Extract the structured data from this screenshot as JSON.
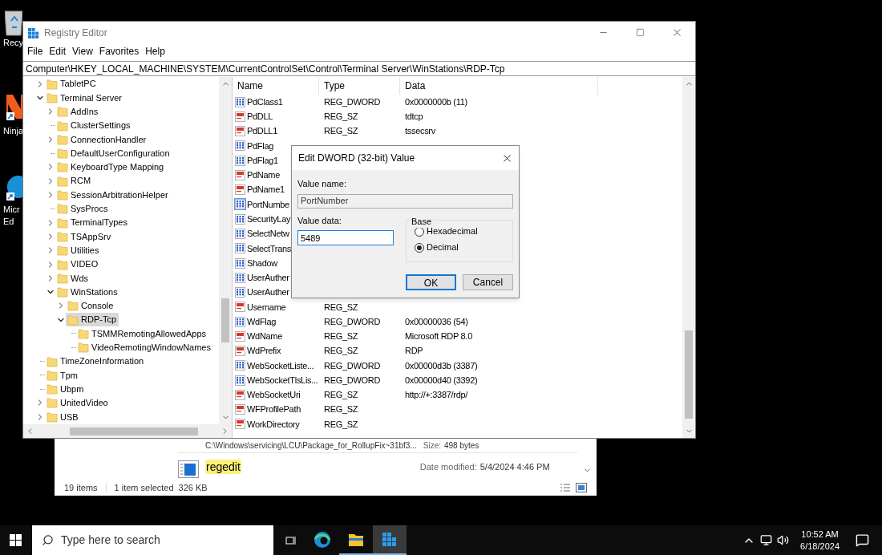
{
  "desktop_icons": [
    {
      "kind": "recycle-bin",
      "lines": [
        "Recy"
      ]
    },
    {
      "kind": "app",
      "lines": [
        "Ninja"
      ]
    },
    {
      "kind": "browser",
      "lines": [
        "Micr",
        "Ed"
      ]
    }
  ],
  "explorer_window": {
    "partial_result": {
      "path": "C:\\Windows\\servicing\\LCU\\Package_for_RollupFix~31bf3...",
      "size_label": "Size:",
      "size": "498 bytes"
    },
    "result": {
      "name": "regedit",
      "highlighted": true,
      "date_label": "Date modified:",
      "date": "5/4/2024 4:46 PM"
    },
    "status": {
      "items": "19 items",
      "selected": "1 item selected",
      "size": "326 KB"
    }
  },
  "registry_editor": {
    "title": "Registry Editor",
    "menu": [
      "File",
      "Edit",
      "View",
      "Favorites",
      "Help"
    ],
    "address": "Computer\\HKEY_LOCAL_MACHINE\\SYSTEM\\CurrentControlSet\\Control\\Terminal Server\\WinStations\\RDP-Tcp",
    "tree": [
      {
        "label": "TabletPC",
        "has_children": true,
        "expanded": false,
        "selected": false
      },
      {
        "label": "Terminal Server",
        "has_children": true,
        "expanded": true,
        "selected": false,
        "children": [
          {
            "label": "AddIns",
            "has_children": true,
            "expanded": false,
            "selected": false
          },
          {
            "label": "ClusterSettings",
            "has_children": false,
            "selected": false
          },
          {
            "label": "ConnectionHandler",
            "has_children": true,
            "expanded": false,
            "selected": false
          },
          {
            "label": "DefaultUserConfiguration",
            "has_children": false,
            "selected": false
          },
          {
            "label": "KeyboardType Mapping",
            "has_children": true,
            "expanded": false,
            "selected": false
          },
          {
            "label": "RCM",
            "has_children": true,
            "expanded": false,
            "selected": false
          },
          {
            "label": "SessionArbitrationHelper",
            "has_children": true,
            "expanded": false,
            "selected": false
          },
          {
            "label": "SysProcs",
            "has_children": false,
            "selected": false
          },
          {
            "label": "TerminalTypes",
            "has_children": true,
            "expanded": false,
            "selected": false
          },
          {
            "label": "TSAppSrv",
            "has_children": true,
            "expanded": false,
            "selected": false
          },
          {
            "label": "Utilities",
            "has_children": true,
            "expanded": false,
            "selected": false
          },
          {
            "label": "VIDEO",
            "has_children": true,
            "expanded": false,
            "selected": false
          },
          {
            "label": "Wds",
            "has_children": true,
            "expanded": false,
            "selected": false
          },
          {
            "label": "WinStations",
            "has_children": true,
            "expanded": true,
            "selected": false,
            "children": [
              {
                "label": "Console",
                "has_children": true,
                "expanded": false,
                "selected": false
              },
              {
                "label": "RDP-Tcp",
                "has_children": true,
                "expanded": true,
                "selected": true,
                "children": [
                  {
                    "label": "TSMMRemotingAllowedApps",
                    "has_children": false,
                    "selected": false
                  },
                  {
                    "label": "VideoRemotingWindowNames",
                    "has_children": false,
                    "selected": false
                  }
                ]
              }
            ]
          }
        ]
      },
      {
        "label": "TimeZoneInformation",
        "has_children": false,
        "selected": false
      },
      {
        "label": "Tpm",
        "has_children": false,
        "selected": false
      },
      {
        "label": "Ubpm",
        "has_children": false,
        "selected": false
      },
      {
        "label": "UnitedVideo",
        "has_children": true,
        "expanded": false,
        "selected": false
      },
      {
        "label": "USB",
        "has_children": true,
        "expanded": false,
        "selected": false
      }
    ],
    "values": {
      "columns": [
        "Name",
        "Type",
        "Data"
      ],
      "rows": [
        {
          "kind": "dword",
          "name": "PdClass1",
          "type": "REG_DWORD",
          "data": "0x0000000b (11)",
          "selected": false
        },
        {
          "kind": "string",
          "name": "PdDLL",
          "type": "REG_SZ",
          "data": "tdtcp",
          "selected": false
        },
        {
          "kind": "string",
          "name": "PdDLL1",
          "type": "REG_SZ",
          "data": "tssecsrv",
          "selected": false
        },
        {
          "kind": "dword",
          "name": "PdFlag",
          "selected": false
        },
        {
          "kind": "dword",
          "name": "PdFlag1",
          "selected": false
        },
        {
          "kind": "string",
          "name": "PdName",
          "selected": false
        },
        {
          "kind": "string",
          "name": "PdName1",
          "selected": false
        },
        {
          "kind": "dword",
          "name": "PortNumbe",
          "selected": true
        },
        {
          "kind": "dword",
          "name": "SecurityLay",
          "selected": false
        },
        {
          "kind": "dword",
          "name": "SelectNetw",
          "selected": false
        },
        {
          "kind": "dword",
          "name": "SelectTrans",
          "selected": false
        },
        {
          "kind": "dword",
          "name": "Shadow",
          "selected": false
        },
        {
          "kind": "dword",
          "name": "UserAuther",
          "selected": false
        },
        {
          "kind": "dword",
          "name": "UserAuther",
          "selected": false
        },
        {
          "kind": "string",
          "name": "Username",
          "type": "REG_SZ",
          "selected": false
        },
        {
          "kind": "dword",
          "name": "WdFlag",
          "type": "REG_DWORD",
          "data": "0x00000036 (54)",
          "selected": false
        },
        {
          "kind": "string",
          "name": "WdName",
          "type": "REG_SZ",
          "data": "Microsoft RDP 8.0",
          "selected": false
        },
        {
          "kind": "string",
          "name": "WdPrefix",
          "type": "REG_SZ",
          "data": "RDP",
          "selected": false
        },
        {
          "kind": "dword",
          "name": "WebSocketListe...",
          "type": "REG_DWORD",
          "data": "0x00000d3b (3387)",
          "selected": false
        },
        {
          "kind": "dword",
          "name": "WebSocketTlsLis...",
          "type": "REG_DWORD",
          "data": "0x00000d40 (3392)",
          "selected": false
        },
        {
          "kind": "string",
          "name": "WebSocketUri",
          "type": "REG_SZ",
          "data": "http://+:3387/rdp/",
          "selected": false
        },
        {
          "kind": "string",
          "name": "WFProfilePath",
          "type": "REG_SZ",
          "selected": false
        },
        {
          "kind": "string",
          "name": "WorkDirectory",
          "type": "REG_SZ",
          "selected": false
        }
      ]
    }
  },
  "dialog": {
    "title": "Edit DWORD (32-bit) Value",
    "value_name_label": "Value name:",
    "value_name": "PortNumber",
    "value_data_label": "Value data:",
    "value_data": "5489",
    "base_label": "Base",
    "base_options": [
      {
        "label": "Hexadecimal",
        "selected": false
      },
      {
        "label": "Decimal",
        "selected": true
      }
    ],
    "buttons": [
      {
        "label": "OK",
        "default": true
      },
      {
        "label": "Cancel",
        "default": false
      }
    ]
  },
  "taskbar": {
    "search_placeholder": "Type here to search",
    "apps": [
      {
        "kind": "browser",
        "running": false,
        "focused": false
      },
      {
        "kind": "files",
        "running": true,
        "focused": false
      },
      {
        "kind": "regedit",
        "running": true,
        "focused": true
      }
    ],
    "time": "10:52 AM",
    "date": "6/18/2024"
  }
}
